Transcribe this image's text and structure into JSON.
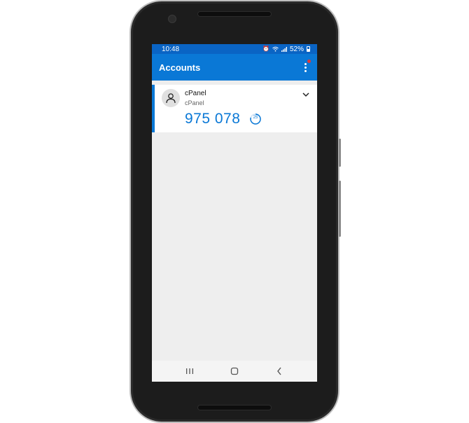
{
  "status_bar": {
    "time": "10:48",
    "battery": "52%",
    "icons": [
      "alarm-icon",
      "wifi-icon",
      "signal-icon",
      "battery-icon"
    ]
  },
  "app_bar": {
    "title": "Accounts",
    "menu_icon": "more-vertical-icon",
    "has_notification": true
  },
  "accounts": [
    {
      "name": "cPanel",
      "issuer": "cPanel",
      "code": "975 078",
      "seconds_remaining": "25",
      "avatar_icon": "person-icon",
      "expand_icon": "chevron-down-icon"
    }
  ],
  "nav_bar": {
    "buttons": [
      "recents-icon",
      "home-icon",
      "back-icon"
    ]
  },
  "colors": {
    "app_bar": "#0a78d6",
    "status_bar": "#0a64c4",
    "accent": "#0a78d6",
    "background": "#eeeeee"
  }
}
